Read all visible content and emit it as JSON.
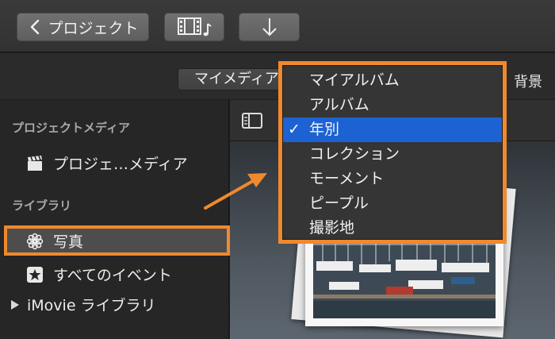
{
  "toolbar": {
    "back_label": "プロジェクト"
  },
  "segment": {
    "media_label": "マイメディア",
    "background_label": "背景"
  },
  "sidebar": {
    "project_media_heading": "プロジェクトメディア",
    "project_media_item": "プロジェ…メディア",
    "library_heading": "ライブラリ",
    "photos_item": "写真",
    "all_events_item": "すべてのイベント",
    "imovie_library_item": "iMovie ライブラリ"
  },
  "popup_menu": {
    "items": [
      {
        "label": "マイアルバム",
        "checked": false
      },
      {
        "label": "アルバム",
        "checked": false
      },
      {
        "label": "年別",
        "checked": true
      },
      {
        "label": "コレクション",
        "checked": false
      },
      {
        "label": "モーメント",
        "checked": false
      },
      {
        "label": "ピープル",
        "checked": false
      },
      {
        "label": "撮影地",
        "checked": false
      }
    ],
    "check_mark": "✓"
  },
  "colors": {
    "highlight_orange": "#f0892e",
    "menu_selection_blue": "#1c62d2"
  }
}
